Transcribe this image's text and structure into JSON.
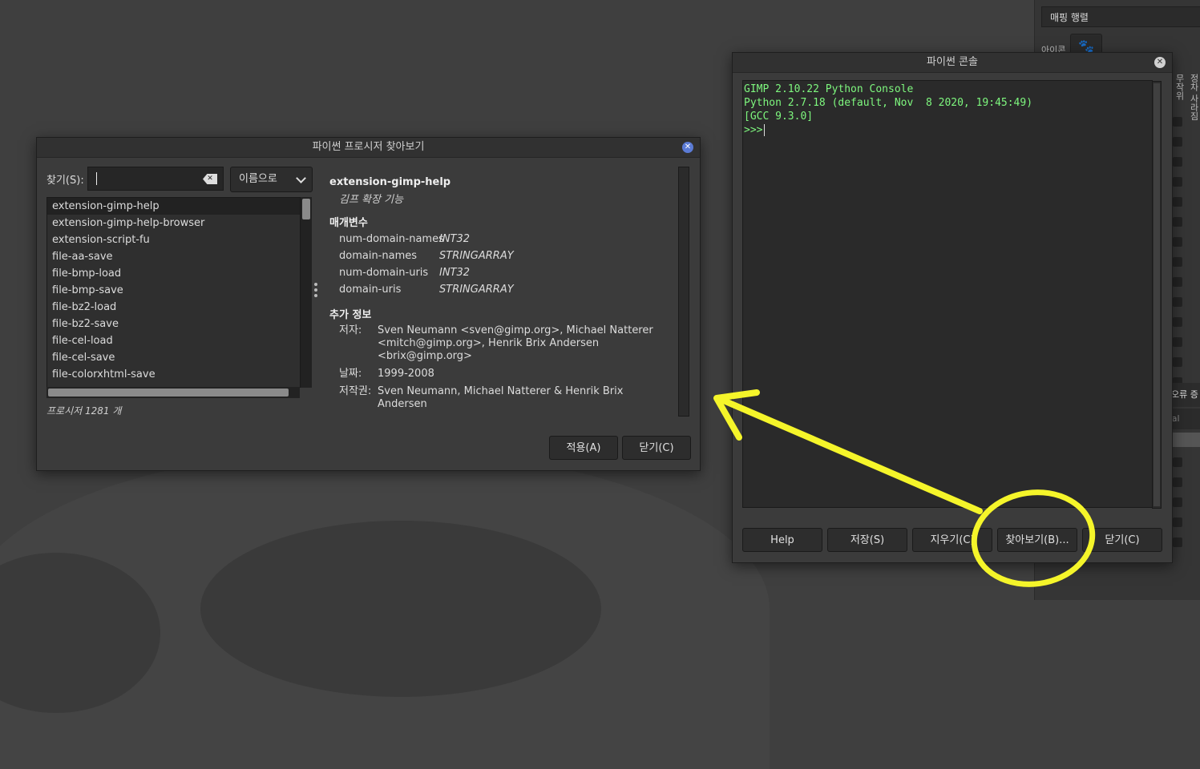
{
  "dock": {
    "combo_label": "매핑 행렬",
    "icon_label": "아이콘",
    "icon_glyph": "🐾",
    "vertical_label_1": "무작위",
    "vertical_label_2": "정차 사라짐",
    "mid_label": "오류 증",
    "mode_label": "mal"
  },
  "console": {
    "title": "파이썬 콘솔",
    "lines": [
      "GIMP 2.10.22 Python Console",
      "Python 2.7.18 (default, Nov  8 2020, 19:45:49)",
      "[GCC 9.3.0]",
      ">>>"
    ],
    "buttons": {
      "help": "Help",
      "save": "저장(S)",
      "clear": "지우기(C)",
      "browse": "찾아보기(B)...",
      "close": "닫기(C)"
    }
  },
  "browser": {
    "title": "파이썬 프로시저 찾아보기",
    "search_label": "찾기(S):",
    "search_value": "",
    "sort_mode": "이름으로",
    "procedures": [
      "extension-gimp-help",
      "extension-gimp-help-browser",
      "extension-script-fu",
      "file-aa-save",
      "file-bmp-load",
      "file-bmp-save",
      "file-bz2-load",
      "file-bz2-save",
      "file-cel-load",
      "file-cel-save",
      "file-colorxhtml-save"
    ],
    "count": "프로시저 1281 개",
    "detail": {
      "name": "extension-gimp-help",
      "blurb": "김프 확장 기능",
      "params_heading": "매개변수",
      "params": [
        {
          "name": "num-domain-names",
          "type": "INT32"
        },
        {
          "name": "domain-names",
          "type": "STRINGARRAY"
        },
        {
          "name": "num-domain-uris",
          "type": "INT32"
        },
        {
          "name": "domain-uris",
          "type": "STRINGARRAY"
        }
      ],
      "info_heading": "추가 정보",
      "author_key": "저자:",
      "author_val": "Sven Neumann <sven@gimp.org>, Michael Natterer <mitch@gimp.org>, Henrik Brix Andersen <brix@gimp.org>",
      "date_key": "날짜:",
      "date_val": "1999-2008",
      "copyright_key": "저작권:",
      "copyright_val": "Sven Neumann, Michael Natterer & Henrik Brix Andersen"
    },
    "buttons": {
      "apply": "적용(A)",
      "close": "닫기(C)"
    }
  },
  "colors": {
    "console_text": "#7ef77e",
    "annotation": "#f5f52a",
    "close_icon_browser": "#5b7bd5",
    "close_icon_console": "#d0d0d0"
  }
}
